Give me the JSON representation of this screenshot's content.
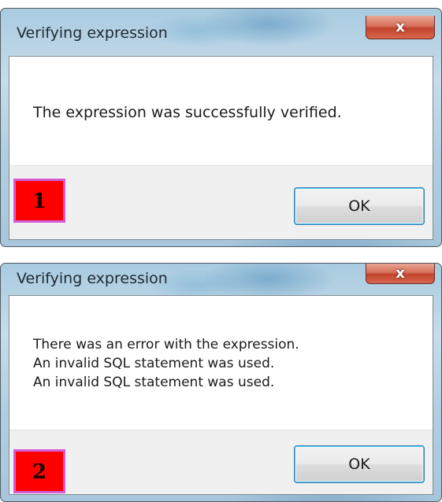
{
  "dialogs": [
    {
      "title": "Verifying expression",
      "close_glyph": "x",
      "message_lines": [
        "The expression was successfully verified."
      ],
      "ok_label": "OK",
      "badge": "1"
    },
    {
      "title": "Verifying expression",
      "close_glyph": "x",
      "message_lines": [
        "There was an error with the expression.",
        "An invalid SQL statement was used.",
        "An invalid SQL statement was used."
      ],
      "ok_label": "OK",
      "badge": "2"
    }
  ],
  "colors": {
    "badge_fill": "#ff0000",
    "badge_border": "#d45ad6",
    "close_button": "#c2442c",
    "ok_button_focus": "#48c6f2"
  },
  "icons": {
    "close": "close-icon"
  }
}
